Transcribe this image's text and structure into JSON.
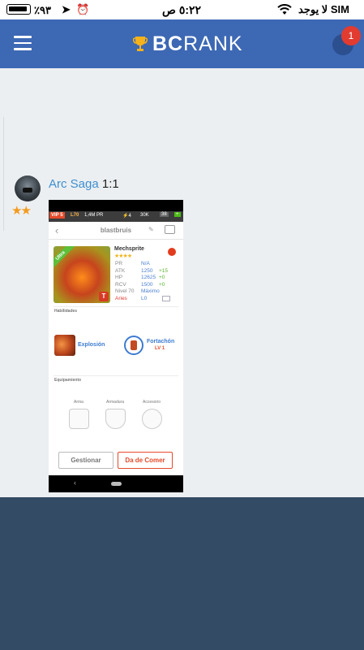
{
  "status_bar": {
    "battery": "٪٩٣",
    "time": "٥:٢٢ ص",
    "carrier": "لا يوجد SIM"
  },
  "header": {
    "brand_bold": "BC",
    "brand_light": "RANK",
    "notification_count": "1"
  },
  "post": {
    "username": "Arc Saga",
    "ratio": "1:1",
    "stars": "★★"
  },
  "screenshot": {
    "vip": "VIP 5",
    "level": "L70",
    "pr": "1,4M PR",
    "energy": "⚡4",
    "gold": "30K",
    "gems": "38",
    "plus": "+",
    "hero_name": "blastbruis",
    "class_name": "Mechsprite",
    "hero_stars": "★★★★",
    "ultra": "Ultra",
    "t_badge": "T",
    "stats": [
      {
        "k": "PR",
        "v": "N/A",
        "d": ""
      },
      {
        "k": "ATK",
        "v": "1250",
        "d": "+15"
      },
      {
        "k": "HP",
        "v": "12625",
        "d": "+0"
      },
      {
        "k": "RCV",
        "v": "1500",
        "d": "+0"
      },
      {
        "k": "Nivel 70",
        "v": "Máximo",
        "d": ""
      },
      {
        "k": "Aries",
        "v": "L0",
        "d": ""
      }
    ],
    "habilidades_label": "Habilidades",
    "skill1": "Explosión",
    "skill2": "Fortachón",
    "skill2_level": "LV 1",
    "equipamiento_label": "Equipamiento",
    "eq_arma": "Arma",
    "eq_armadura": "Armadura",
    "eq_accesorio": "Accesorio",
    "btn_gestionar": "Gestionar",
    "btn_comer": "Da de Comer"
  }
}
